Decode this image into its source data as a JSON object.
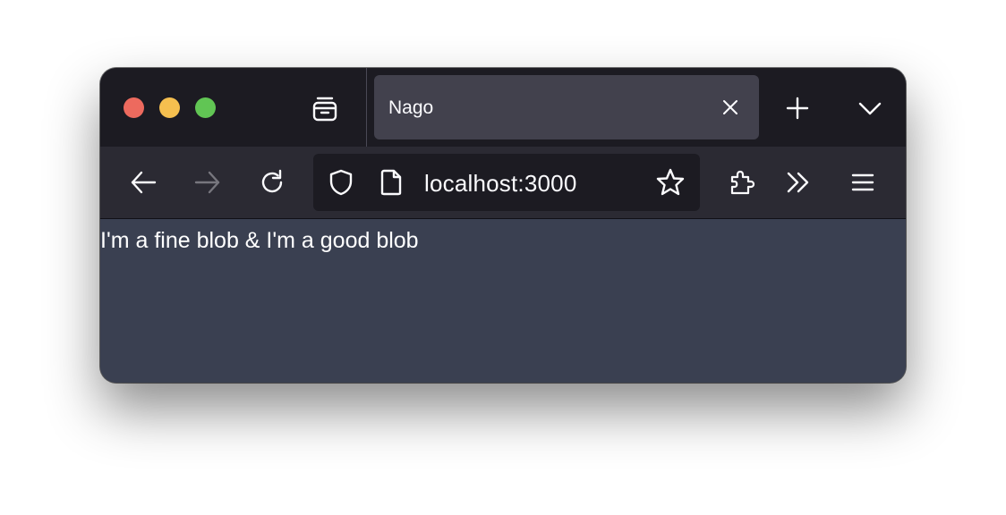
{
  "window": {
    "controls": {
      "close": "close-button",
      "minimize": "minimize-button",
      "maximize": "maximize-button"
    }
  },
  "tabs": [
    {
      "title": "Nago",
      "active": true
    }
  ],
  "toolbar": {
    "url": "localhost:3000",
    "icons": [
      "back-arrow-icon",
      "forward-arrow-icon",
      "reload-icon",
      "shield-icon",
      "page-icon",
      "star-icon",
      "extensions-icon",
      "overflow-chevrons-icon",
      "hamburger-menu-icon"
    ]
  },
  "page": {
    "text": "I'm a fine blob & I'm a good blob"
  },
  "colors": {
    "titlebar": "#1c1b22",
    "toolbar": "#2b2a33",
    "active_tab": "#42414d",
    "content_bg": "#3a4051",
    "close": "#ed6a5e",
    "minimize": "#f5bf4f",
    "maximize": "#61c554"
  }
}
